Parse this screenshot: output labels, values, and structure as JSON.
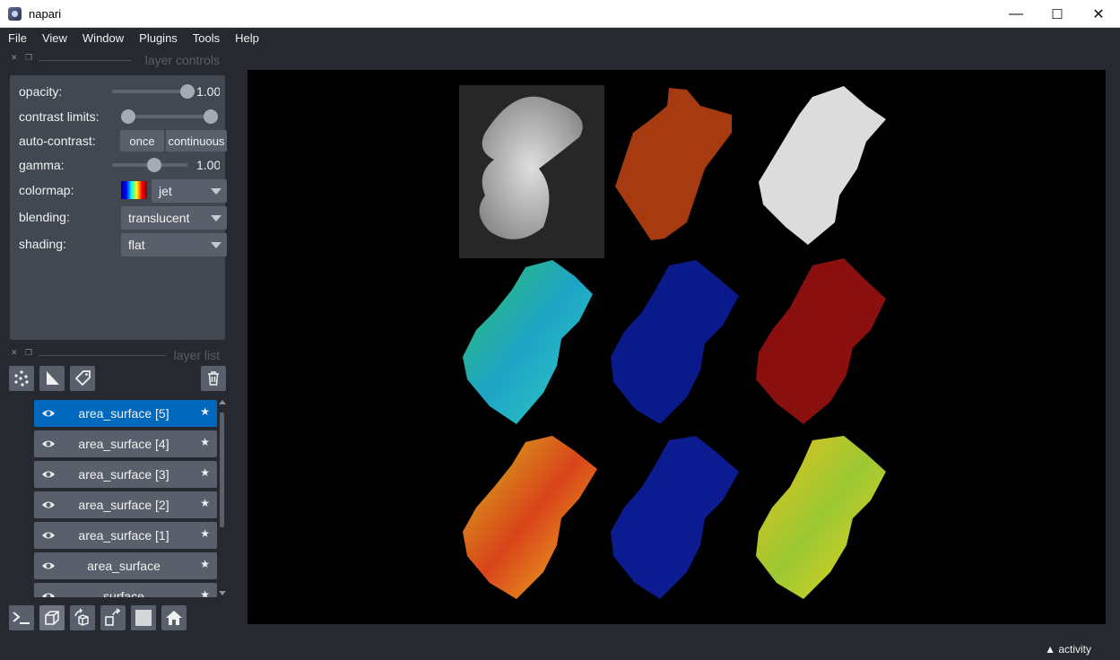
{
  "window": {
    "title": "napari",
    "minimize": "—",
    "maximize": "☐",
    "close": "✕"
  },
  "menu": [
    "File",
    "View",
    "Window",
    "Plugins",
    "Tools",
    "Help"
  ],
  "layer_controls": {
    "title": "layer controls",
    "opacity_label": "opacity:",
    "opacity_value": "1.00",
    "contrast_label": "contrast limits:",
    "autocontrast_label": "auto-contrast:",
    "once_label": "once",
    "continuous_label": "continuous",
    "gamma_label": "gamma:",
    "gamma_value": "1.00",
    "colormap_label": "colormap:",
    "colormap_value": "jet",
    "blending_label": "blending:",
    "blending_value": "translucent",
    "shading_label": "shading:",
    "shading_value": "flat"
  },
  "layer_list": {
    "title": "layer list",
    "layers": [
      {
        "name": "area_surface [5]",
        "selected": true
      },
      {
        "name": "area_surface [4]",
        "selected": false
      },
      {
        "name": "area_surface [3]",
        "selected": false
      },
      {
        "name": "area_surface [2]",
        "selected": false
      },
      {
        "name": "area_surface [1]",
        "selected": false
      },
      {
        "name": "area_surface",
        "selected": false
      },
      {
        "name": "surface",
        "selected": false
      }
    ]
  },
  "status": {
    "activity_label": "activity"
  },
  "colors": {
    "selected": "#0069be",
    "panel": "#414851",
    "background": "#262930",
    "button": "#5a606b"
  }
}
